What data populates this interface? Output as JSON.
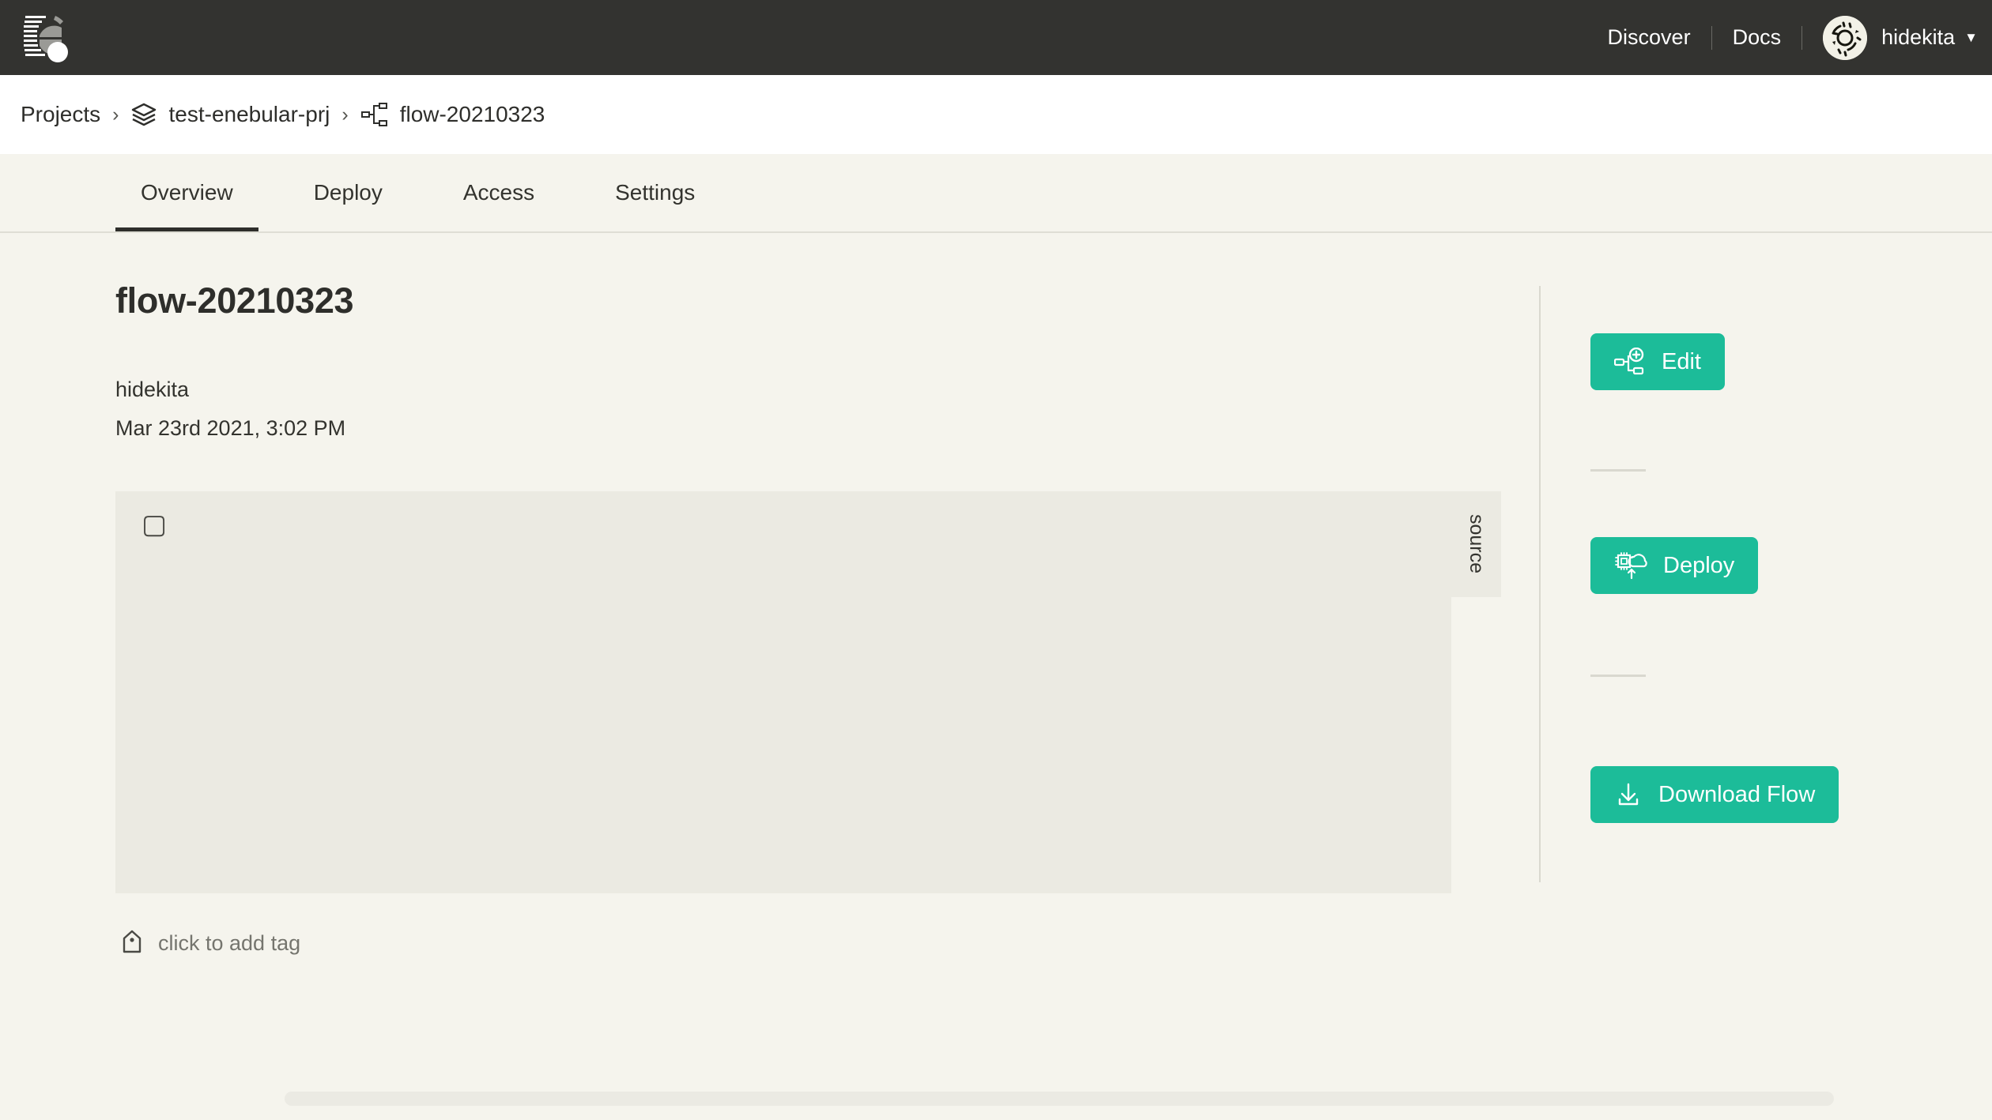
{
  "header": {
    "logo_icon": "enebular-logo-icon",
    "nav": [
      {
        "label": "Discover",
        "name": "discover"
      },
      {
        "label": "Docs",
        "name": "docs"
      }
    ],
    "avatar_icon": "user-avatar-identicon",
    "user_name": "hidekita",
    "caret_glyph": "▼"
  },
  "breadcrumb": {
    "projects_label": "Projects",
    "separator": "›",
    "project_icon": "layers-icon",
    "project_label": "test-enebular-prj",
    "flow_icon": "flow-nodes-icon",
    "flow_label": "flow-20210323"
  },
  "tabs": [
    {
      "label": "Overview",
      "name": "overview",
      "active": true
    },
    {
      "label": "Deploy",
      "name": "deploy",
      "active": false
    },
    {
      "label": "Access",
      "name": "access",
      "active": false
    },
    {
      "label": "Settings",
      "name": "settings",
      "active": false
    }
  ],
  "main": {
    "title": "flow-20210323",
    "author": "hidekita",
    "date": "Mar 23rd 2021, 3:02 PM",
    "preview_glyph": "▢",
    "source_tab_label": "source",
    "tag_icon": "tag-icon",
    "tag_placeholder": "click to add tag"
  },
  "actions": [
    {
      "label": "Edit",
      "icon": "flow-add-icon",
      "name": "edit"
    },
    {
      "label": "Deploy",
      "icon": "chip-cloud-upload-icon",
      "name": "deploy"
    },
    {
      "label": "Download Flow",
      "icon": "download-icon",
      "name": "download-flow"
    }
  ],
  "colors": {
    "header_bg": "#333330",
    "page_bg": "#F5F4ED",
    "panel_bg": "#EBEAE2",
    "accent": "#1CBC99",
    "text": "#33332E",
    "muted_text": "#75756E"
  }
}
